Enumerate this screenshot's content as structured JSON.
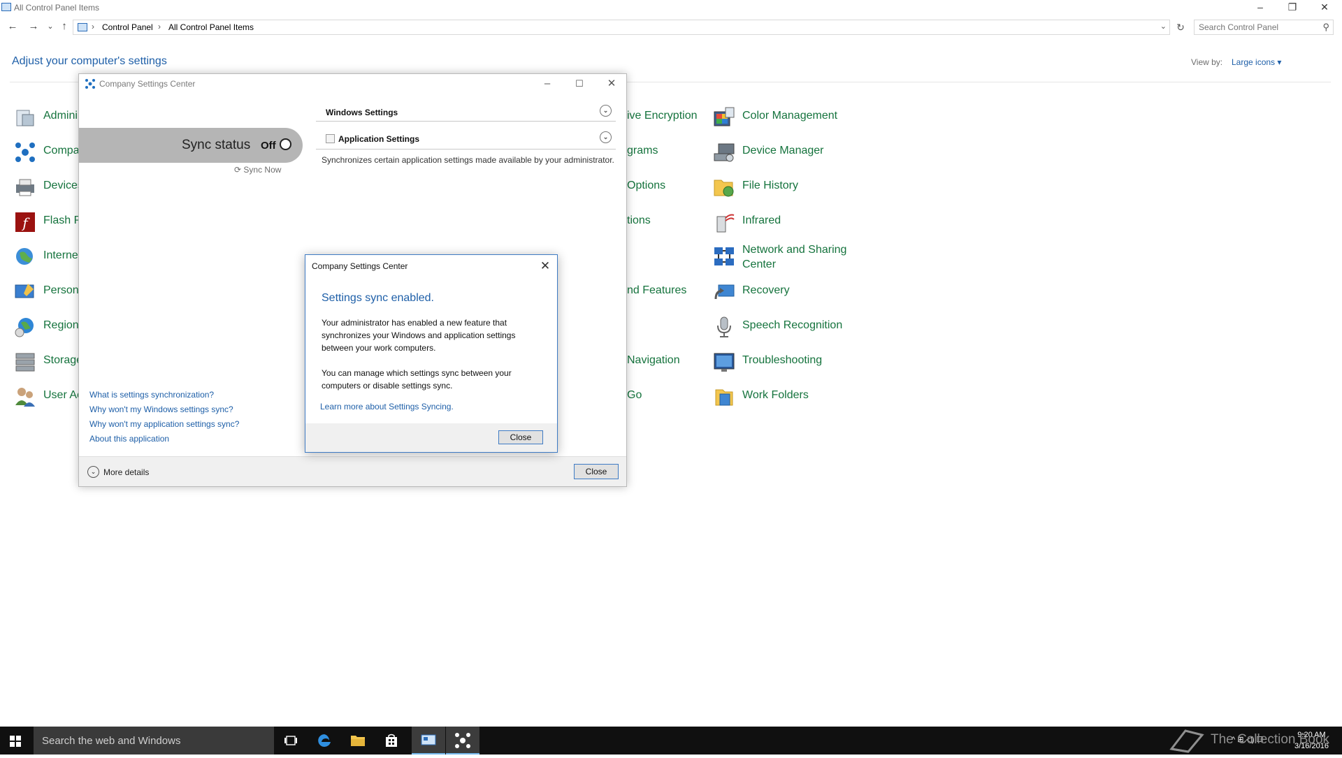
{
  "window": {
    "title": "All Control Panel Items",
    "min_glyph": "–",
    "restore_glyph": "❐",
    "close_glyph": "✕"
  },
  "nav": {
    "back": "←",
    "forward": "→",
    "recent": "⌄",
    "up": "↑",
    "chevron": "›",
    "breadcrumbs": [
      "Control Panel",
      "All Control Panel Items"
    ],
    "dropdown": "⌄",
    "refresh": "↻",
    "search_placeholder": "Search Control Panel",
    "search_glyph": "⚲"
  },
  "page": {
    "heading": "Adjust your computer's settings",
    "view_by_label": "View by:",
    "view_by_value": "Large icons ▾"
  },
  "items": {
    "col1": [
      "Admini",
      "Compa",
      "Devices",
      "Flash P",
      "Interne",
      "Persona",
      "Region",
      "Storage",
      "User Ac"
    ],
    "col3": [
      "ive Encryption",
      "grams",
      "Options",
      "tions",
      "nd Features",
      "Navigation",
      "Go"
    ],
    "col4": [
      "Color Management",
      "Device Manager",
      "File History",
      "Infrared",
      "Network and Sharing Center",
      "Recovery",
      "Speech Recognition",
      "Troubleshooting",
      "Work Folders"
    ]
  },
  "csc": {
    "title": "Company Settings Center",
    "min_glyph": "–",
    "max_glyph": "☐",
    "close_glyph": "✕",
    "sync_status_label": "Sync status",
    "sync_status_value": "Off",
    "sync_now": "⟳ Sync Now",
    "windows_settings": "Windows Settings",
    "application_settings": "Application Settings",
    "app_settings_desc": "Synchronizes certain application settings made available by your administrator.",
    "chevron": "⌄",
    "links": [
      "What is settings synchronization?",
      "Why won't my Windows settings sync?",
      "Why won't my application settings sync?",
      "About this application"
    ],
    "more_details": "More details",
    "close_button": "Close"
  },
  "dialog": {
    "title": "Company Settings Center",
    "close_glyph": "✕",
    "heading": "Settings sync enabled.",
    "para1": "Your administrator has enabled a new feature that synchronizes your Windows and application settings between your work computers.",
    "para2": "You can manage which settings sync between your computers or disable settings sync.",
    "link": "Learn more about Settings Syncing.",
    "close_button": "Close"
  },
  "taskbar": {
    "search_placeholder": "Search the web and Windows",
    "time": "9:20 AM",
    "date": "3/16/2016",
    "watermark": "The Collection Book",
    "tray_glyphs": "^  ⊞  ◁)  ☐"
  },
  "colors": {
    "link_blue": "#1e5fa8",
    "cp_green": "#15733d",
    "band_gray": "#b5b5b5",
    "taskbar": "#101010"
  }
}
